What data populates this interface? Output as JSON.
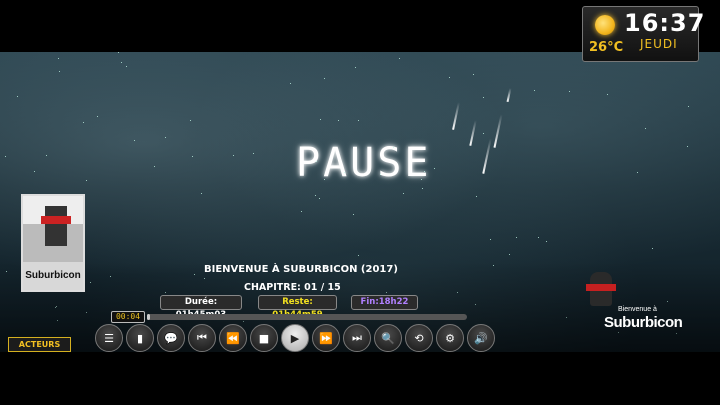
{
  "clock": {
    "time": "16:37",
    "day": "JEUDI",
    "temperature": "26°C",
    "weather_icon": "sun-icon"
  },
  "overlay": {
    "status": "PAUSE"
  },
  "media": {
    "title": "BIENVENUE À SUBURBICON (2017)",
    "chapter": "CHAPITRE: 01 / 15",
    "duration": "Durée: 01h45m03",
    "remaining": "Reste: 01h44m59",
    "end_time": "Fin:18h22",
    "elapsed": "00:04",
    "progress": 0.01,
    "poster_title": "Suburbicon",
    "logo_small": "Bienvenue à",
    "logo_title": "Suburbicon"
  },
  "actors_button": "ACTEURS",
  "controls": [
    {
      "name": "menu-list-icon",
      "glyph": "☰"
    },
    {
      "name": "bookmark-icon",
      "glyph": "▮"
    },
    {
      "name": "subtitles-icon",
      "glyph": "💬"
    },
    {
      "name": "skip-previous-icon",
      "glyph": "⏮"
    },
    {
      "name": "rewind-icon",
      "glyph": "⏪"
    },
    {
      "name": "stop-icon",
      "glyph": "■"
    },
    {
      "name": "play-icon",
      "glyph": "▶"
    },
    {
      "name": "fast-forward-icon",
      "glyph": "⏩"
    },
    {
      "name": "skip-next-icon",
      "glyph": "⏭"
    },
    {
      "name": "search-icon",
      "glyph": "🔍"
    },
    {
      "name": "repeat-icon",
      "glyph": "⟲"
    },
    {
      "name": "settings-gear-icon",
      "glyph": "⚙"
    },
    {
      "name": "volume-icon",
      "glyph": "🔊"
    }
  ],
  "colors": {
    "accent_yellow": "#f2c022",
    "remaining_yellow": "#f2e020",
    "end_purple": "#b080ff"
  }
}
